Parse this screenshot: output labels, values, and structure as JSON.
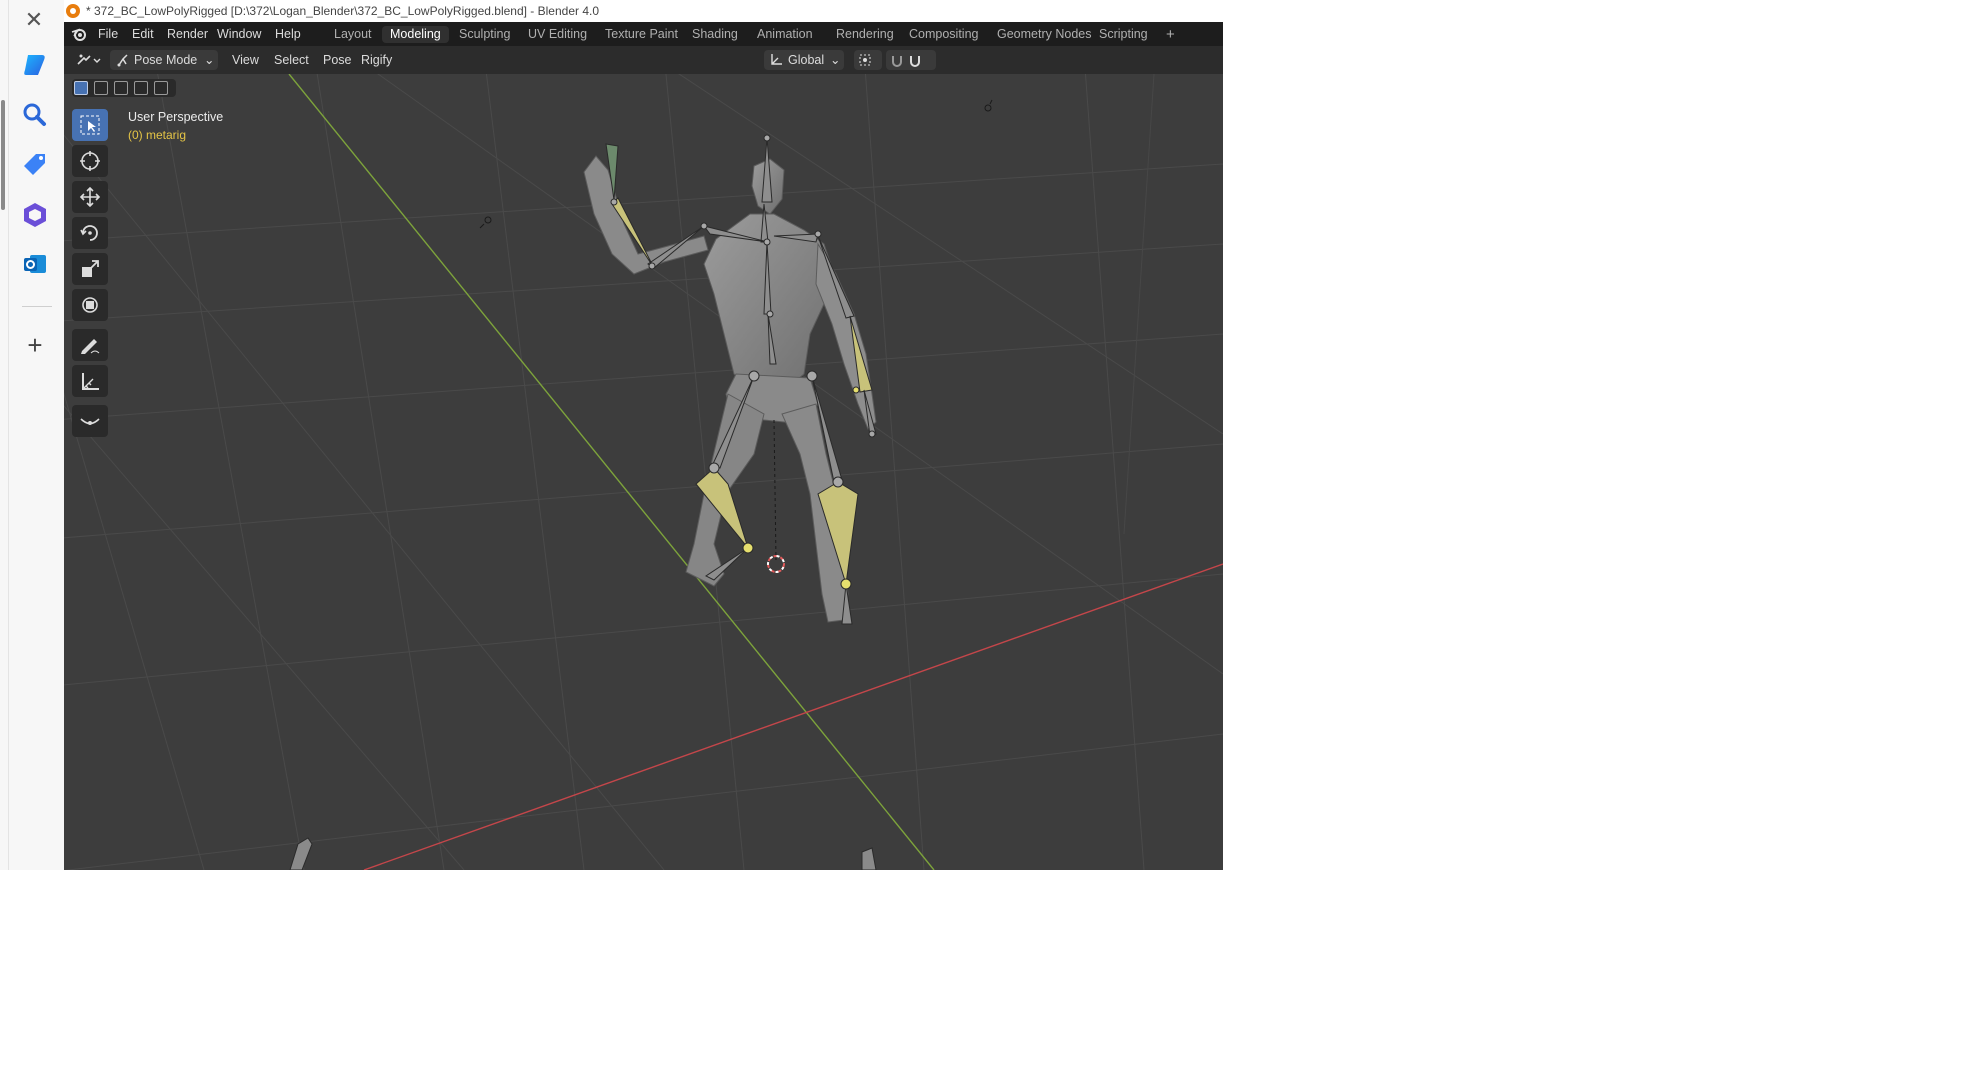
{
  "window": {
    "title": "* 372_BC_LowPolyRigged [D:\\372\\Logan_Blender\\372_BC_LowPolyRigged.blend] - Blender 4.0"
  },
  "menus": [
    "File",
    "Edit",
    "Render",
    "Window",
    "Help"
  ],
  "workspaces": [
    {
      "label": "Layout"
    },
    {
      "label": "Modeling",
      "active": true
    },
    {
      "label": "Sculpting"
    },
    {
      "label": "UV Editing"
    },
    {
      "label": "Texture Paint"
    },
    {
      "label": "Shading"
    },
    {
      "label": "Animation"
    },
    {
      "label": "Rendering"
    },
    {
      "label": "Compositing"
    },
    {
      "label": "Geometry Nodes"
    },
    {
      "label": "Scripting"
    }
  ],
  "add_workspace": "+",
  "header": {
    "mode": "Pose Mode",
    "view": "View",
    "select": "Select",
    "pose": "Pose",
    "rigify": "Rigify",
    "orientation": "Global"
  },
  "viewport": {
    "overlay_title": "User Perspective",
    "overlay_object": "(0) metarig"
  },
  "tools": [
    "select-box-icon",
    "cursor-icon",
    "move-icon",
    "rotate-icon",
    "scale-icon",
    "transform-icon",
    "annotate-icon",
    "measure-icon",
    "bone-roll-icon"
  ],
  "sidebar_icons": [
    "close-icon",
    "copilot-icon",
    "search-icon",
    "shopping-tag-icon",
    "office-icon",
    "outlook-icon",
    "add-icon"
  ],
  "colors": {
    "viewport_bg": "#3d3d3d",
    "active_blue": "#4772b3",
    "bone_selected": "#c8c27a",
    "axis_x": "#c4464a",
    "axis_y": "#7da33b",
    "object_label": "#e5c546"
  }
}
